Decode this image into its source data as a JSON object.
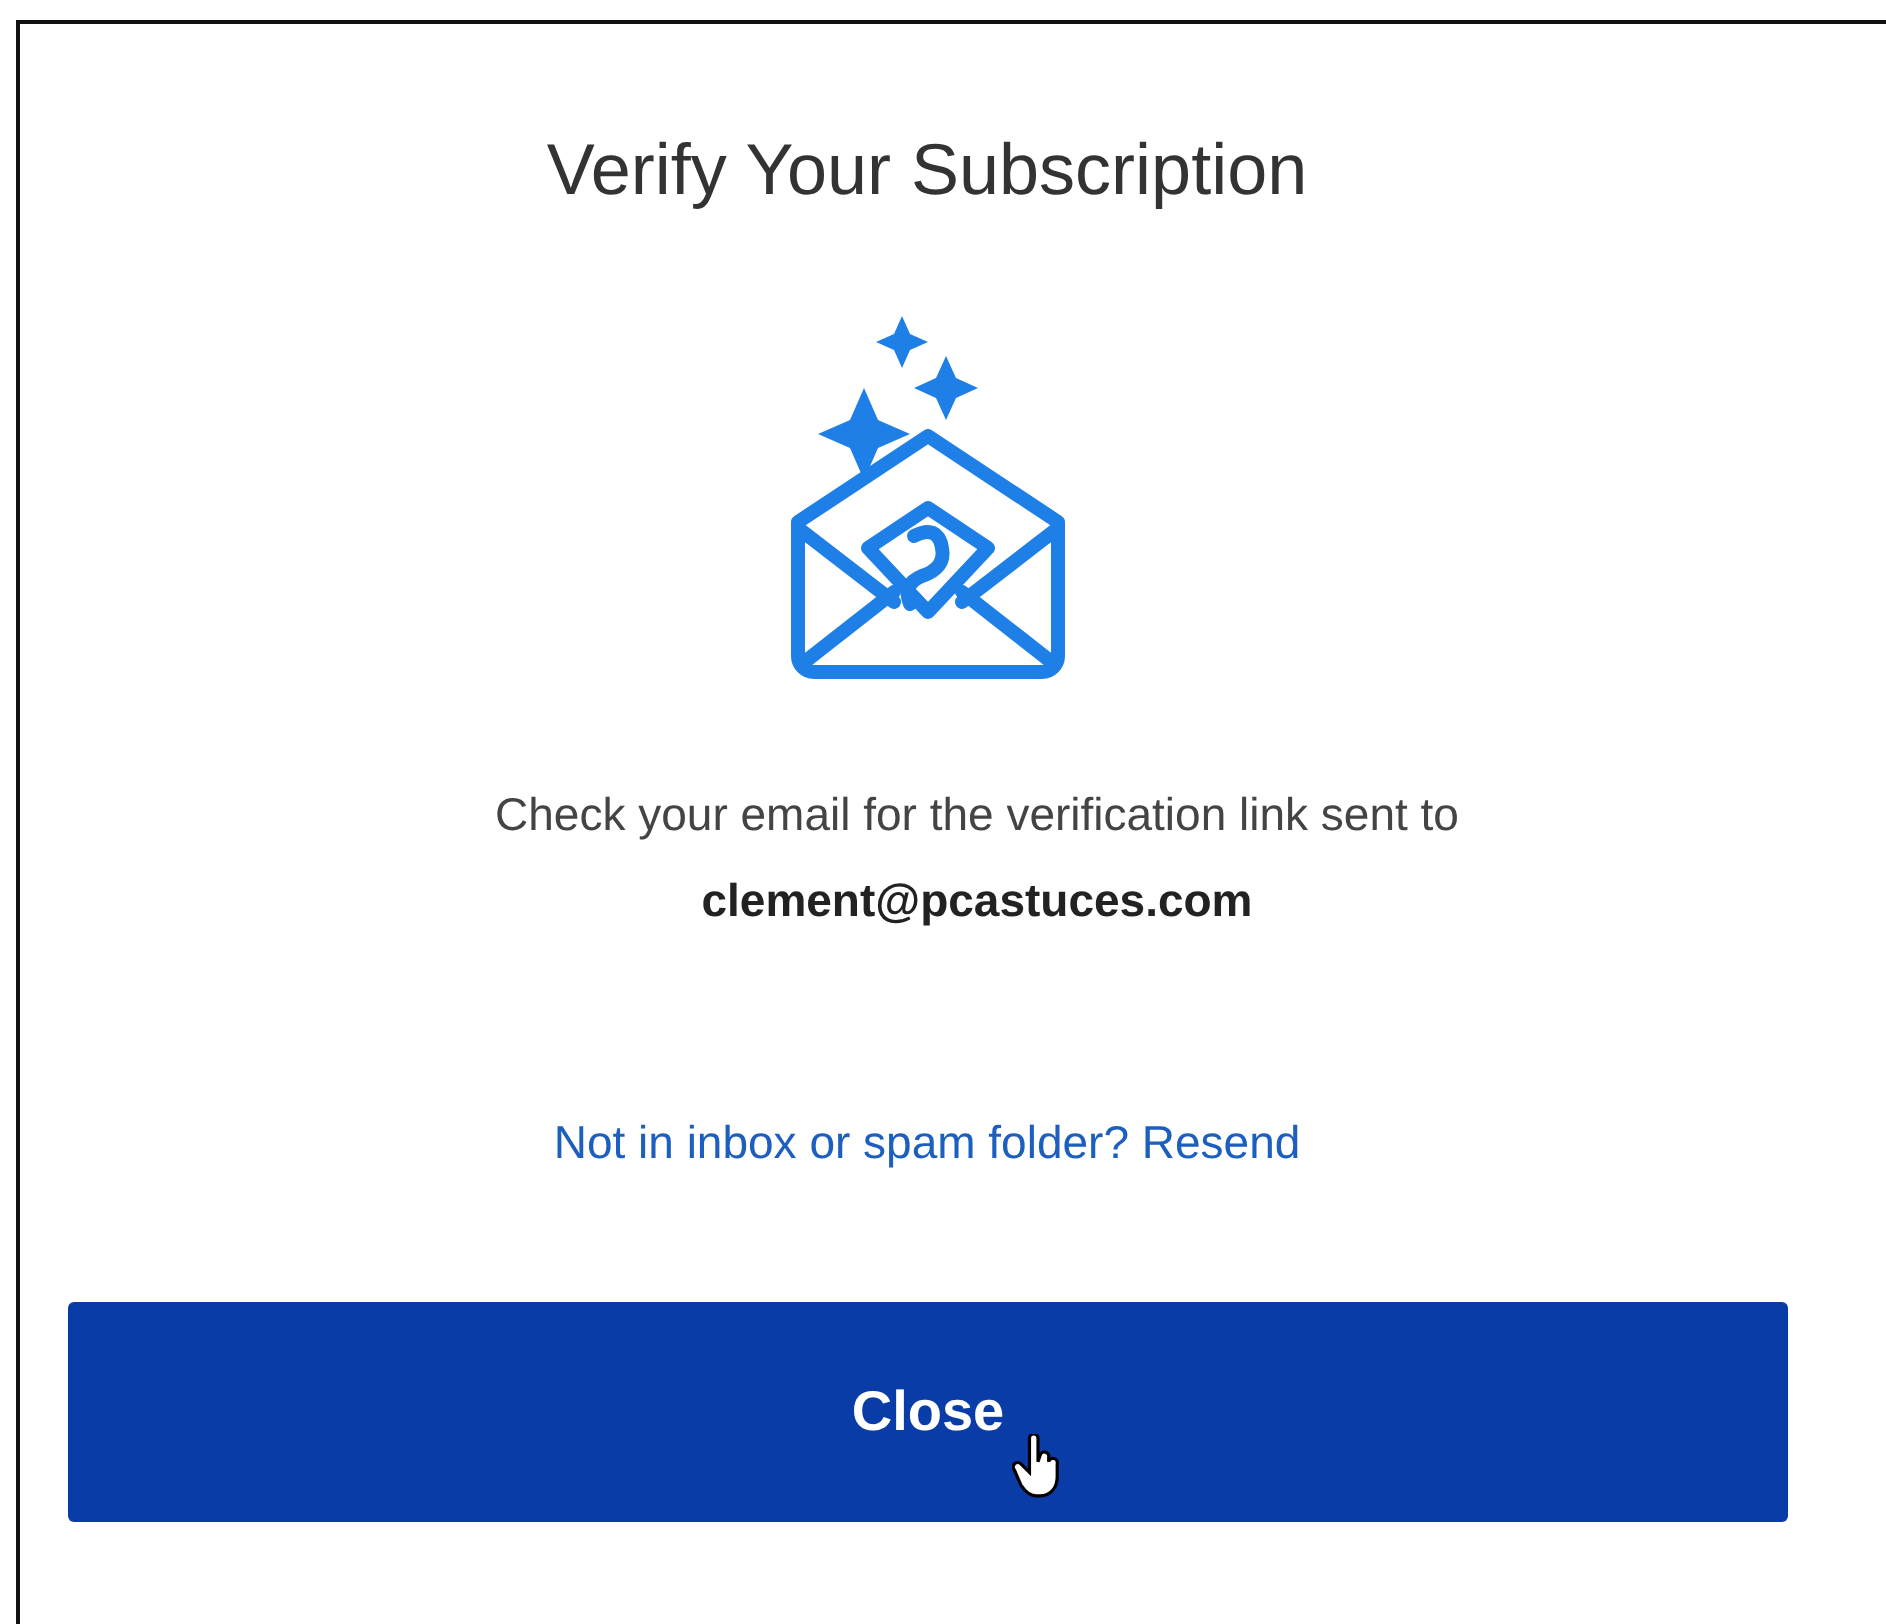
{
  "dialog": {
    "title": "Verify Your Subscription",
    "message": "Check your email for the verification link sent to",
    "email": "clement@pcastuces.com",
    "resend_link": "Not in inbox or spam folder? Resend",
    "button": "Close"
  }
}
